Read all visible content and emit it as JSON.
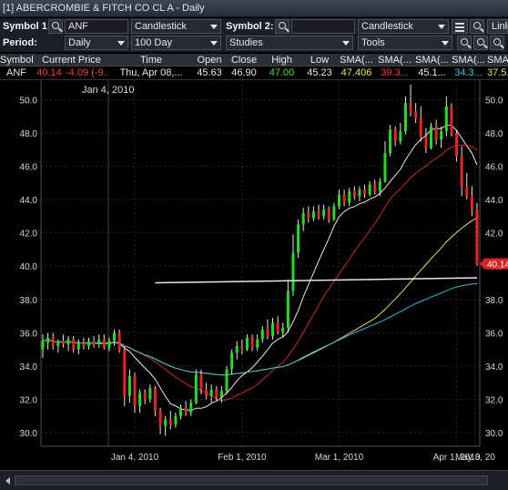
{
  "window": {
    "title": "[1] ABERCROMBIE & FITCH CO CL A - Daily"
  },
  "toolbar": {
    "symbol1_label": "Symbol 1:",
    "symbol1_value": "ANF",
    "chart_type1": "Candlestick",
    "symbol2_label": "Symbol 2:",
    "symbol2_value": "",
    "chart_type2": "Candlestick",
    "link_label": "Link",
    "period_label": "Period:",
    "period_value": "Daily",
    "range_value": "100 Day",
    "studies_label": "Studies",
    "tools_label": "Tools"
  },
  "quote": {
    "headers": [
      "Symbol",
      "Current Price",
      "Time",
      "Open",
      "Close",
      "High",
      "Low",
      "SMA(...",
      "SMA(...",
      "SMA(...",
      "SMA(...",
      "SMA(..."
    ],
    "row": [
      "ANF",
      "40.14",
      "-4.09 (-9...",
      "Thu, Apr 08,...",
      "45.63",
      "46.90",
      "47.00",
      "45.23",
      "47.406",
      "39.3...",
      "45.1...",
      "34.3...",
      "37.5..."
    ]
  },
  "colors": {
    "background": "#000000",
    "up_candle": "#22dd22",
    "down_candle": "#ee2222",
    "sma_white": "#e8e8e8",
    "sma_yellow": "#e2e255",
    "sma_red": "#cc2a2a",
    "sma_cyan": "#33bbcc",
    "price_tag": "#e02020"
  },
  "chart_data": {
    "type": "candlestick",
    "top_date_label": "Jan 4, 2010",
    "y_ticks": [
      "50.0",
      "48.0",
      "46.0",
      "44.0",
      "42.0",
      "40.0",
      "38.0",
      "36.0",
      "34.0",
      "32.0",
      "30.0"
    ],
    "x_ticks": [
      "Jan 4, 2010",
      "Feb 1, 2010",
      "Mar 1, 2010",
      "Apr 1, 2010",
      "May 3, 20"
    ],
    "ylim": [
      29.4,
      50.9
    ],
    "last_price_label": "40.14",
    "trendline": {
      "from": [
        22,
        39.0
      ],
      "to": [
        85,
        39.3
      ]
    },
    "candles": [
      {
        "o": 35.0,
        "h": 35.9,
        "l": 34.5,
        "c": 35.5
      },
      {
        "o": 35.4,
        "h": 36.0,
        "l": 35.0,
        "c": 35.7
      },
      {
        "o": 35.7,
        "h": 36.0,
        "l": 35.0,
        "c": 35.2
      },
      {
        "o": 35.2,
        "h": 35.6,
        "l": 34.8,
        "c": 35.5
      },
      {
        "o": 35.5,
        "h": 35.9,
        "l": 35.1,
        "c": 35.3
      },
      {
        "o": 35.3,
        "h": 35.8,
        "l": 34.9,
        "c": 35.6
      },
      {
        "o": 35.6,
        "h": 35.8,
        "l": 34.8,
        "c": 35.0
      },
      {
        "o": 35.0,
        "h": 35.6,
        "l": 34.7,
        "c": 35.4
      },
      {
        "o": 35.4,
        "h": 35.7,
        "l": 35.0,
        "c": 35.2
      },
      {
        "o": 35.2,
        "h": 35.7,
        "l": 35.0,
        "c": 35.5
      },
      {
        "o": 35.5,
        "h": 35.8,
        "l": 35.1,
        "c": 35.3
      },
      {
        "o": 35.3,
        "h": 35.9,
        "l": 35.1,
        "c": 35.6
      },
      {
        "o": 35.6,
        "h": 35.9,
        "l": 35.0,
        "c": 35.1
      },
      {
        "o": 35.1,
        "h": 35.7,
        "l": 34.9,
        "c": 35.5
      },
      {
        "o": 35.5,
        "h": 36.2,
        "l": 35.2,
        "c": 36.0
      },
      {
        "o": 36.0,
        "h": 36.2,
        "l": 34.8,
        "c": 35.0
      },
      {
        "o": 35.0,
        "h": 35.2,
        "l": 31.6,
        "c": 32.2
      },
      {
        "o": 32.2,
        "h": 33.8,
        "l": 31.8,
        "c": 33.4
      },
      {
        "o": 33.4,
        "h": 33.6,
        "l": 31.2,
        "c": 31.6
      },
      {
        "o": 31.6,
        "h": 32.6,
        "l": 31.2,
        "c": 32.4
      },
      {
        "o": 32.4,
        "h": 32.6,
        "l": 31.7,
        "c": 32.0
      },
      {
        "o": 32.0,
        "h": 32.9,
        "l": 31.8,
        "c": 32.7
      },
      {
        "o": 32.7,
        "h": 32.8,
        "l": 31.0,
        "c": 31.3
      },
      {
        "o": 31.3,
        "h": 31.5,
        "l": 29.9,
        "c": 30.4
      },
      {
        "o": 30.4,
        "h": 31.0,
        "l": 29.8,
        "c": 30.8
      },
      {
        "o": 30.8,
        "h": 31.3,
        "l": 30.2,
        "c": 30.5
      },
      {
        "o": 30.5,
        "h": 31.2,
        "l": 30.3,
        "c": 31.0
      },
      {
        "o": 31.0,
        "h": 31.7,
        "l": 30.8,
        "c": 31.5
      },
      {
        "o": 31.5,
        "h": 31.9,
        "l": 31.0,
        "c": 31.2
      },
      {
        "o": 31.2,
        "h": 32.0,
        "l": 31.0,
        "c": 31.8
      },
      {
        "o": 31.8,
        "h": 33.8,
        "l": 31.7,
        "c": 33.5
      },
      {
        "o": 33.5,
        "h": 33.8,
        "l": 32.3,
        "c": 32.6
      },
      {
        "o": 32.6,
        "h": 33.0,
        "l": 32.0,
        "c": 32.2
      },
      {
        "o": 32.2,
        "h": 32.9,
        "l": 31.8,
        "c": 32.6
      },
      {
        "o": 32.6,
        "h": 32.8,
        "l": 31.9,
        "c": 32.1
      },
      {
        "o": 32.1,
        "h": 32.8,
        "l": 31.8,
        "c": 32.5
      },
      {
        "o": 32.5,
        "h": 34.0,
        "l": 32.3,
        "c": 33.8
      },
      {
        "o": 33.8,
        "h": 35.0,
        "l": 33.5,
        "c": 34.8
      },
      {
        "o": 34.8,
        "h": 35.5,
        "l": 34.4,
        "c": 35.2
      },
      {
        "o": 35.2,
        "h": 35.6,
        "l": 34.7,
        "c": 35.0
      },
      {
        "o": 35.0,
        "h": 35.9,
        "l": 34.9,
        "c": 35.7
      },
      {
        "o": 35.7,
        "h": 35.9,
        "l": 34.9,
        "c": 35.1
      },
      {
        "o": 35.1,
        "h": 35.9,
        "l": 34.9,
        "c": 35.6
      },
      {
        "o": 35.6,
        "h": 36.4,
        "l": 35.4,
        "c": 36.2
      },
      {
        "o": 36.2,
        "h": 36.8,
        "l": 35.6,
        "c": 35.8
      },
      {
        "o": 35.8,
        "h": 36.9,
        "l": 35.6,
        "c": 36.6
      },
      {
        "o": 36.6,
        "h": 37.0,
        "l": 35.9,
        "c": 36.0
      },
      {
        "o": 36.0,
        "h": 36.6,
        "l": 35.7,
        "c": 36.3
      },
      {
        "o": 36.3,
        "h": 39.2,
        "l": 36.0,
        "c": 38.5
      },
      {
        "o": 38.5,
        "h": 41.9,
        "l": 38.2,
        "c": 40.8
      },
      {
        "o": 40.8,
        "h": 42.8,
        "l": 40.5,
        "c": 42.5
      },
      {
        "o": 42.5,
        "h": 43.5,
        "l": 42.1,
        "c": 43.2
      },
      {
        "o": 43.2,
        "h": 43.6,
        "l": 42.6,
        "c": 42.9
      },
      {
        "o": 42.9,
        "h": 43.6,
        "l": 42.7,
        "c": 43.3
      },
      {
        "o": 43.3,
        "h": 43.7,
        "l": 42.8,
        "c": 43.0
      },
      {
        "o": 43.0,
        "h": 43.7,
        "l": 42.8,
        "c": 43.4
      },
      {
        "o": 43.4,
        "h": 43.6,
        "l": 42.6,
        "c": 42.8
      },
      {
        "o": 42.8,
        "h": 43.8,
        "l": 42.7,
        "c": 43.6
      },
      {
        "o": 43.6,
        "h": 44.6,
        "l": 43.4,
        "c": 44.3
      },
      {
        "o": 44.3,
        "h": 44.6,
        "l": 43.6,
        "c": 43.8
      },
      {
        "o": 43.8,
        "h": 44.7,
        "l": 43.6,
        "c": 44.5
      },
      {
        "o": 44.5,
        "h": 44.8,
        "l": 44.0,
        "c": 44.2
      },
      {
        "o": 44.2,
        "h": 44.8,
        "l": 43.9,
        "c": 44.6
      },
      {
        "o": 44.6,
        "h": 44.9,
        "l": 44.1,
        "c": 44.3
      },
      {
        "o": 44.3,
        "h": 45.1,
        "l": 44.2,
        "c": 44.9
      },
      {
        "o": 44.9,
        "h": 45.2,
        "l": 44.3,
        "c": 44.5
      },
      {
        "o": 44.5,
        "h": 45.3,
        "l": 44.2,
        "c": 45.1
      },
      {
        "o": 45.1,
        "h": 47.5,
        "l": 45.0,
        "c": 46.8
      },
      {
        "o": 46.8,
        "h": 48.5,
        "l": 46.6,
        "c": 48.2
      },
      {
        "o": 48.2,
        "h": 48.4,
        "l": 47.2,
        "c": 47.5
      },
      {
        "o": 47.5,
        "h": 48.6,
        "l": 47.3,
        "c": 48.1
      },
      {
        "o": 48.1,
        "h": 50.2,
        "l": 47.9,
        "c": 49.8
      },
      {
        "o": 49.8,
        "h": 50.9,
        "l": 49.0,
        "c": 49.3
      },
      {
        "o": 49.3,
        "h": 49.8,
        "l": 48.6,
        "c": 48.9
      },
      {
        "o": 48.9,
        "h": 49.6,
        "l": 47.5,
        "c": 47.8
      },
      {
        "o": 47.8,
        "h": 48.3,
        "l": 46.8,
        "c": 47.1
      },
      {
        "o": 47.1,
        "h": 48.6,
        "l": 47.0,
        "c": 48.4
      },
      {
        "o": 48.4,
        "h": 48.8,
        "l": 47.3,
        "c": 47.6
      },
      {
        "o": 47.6,
        "h": 48.4,
        "l": 47.1,
        "c": 48.1
      },
      {
        "o": 48.1,
        "h": 50.2,
        "l": 47.8,
        "c": 49.6
      },
      {
        "o": 49.6,
        "h": 49.8,
        "l": 47.8,
        "c": 48.0
      },
      {
        "o": 48.0,
        "h": 48.2,
        "l": 46.3,
        "c": 46.6
      },
      {
        "o": 46.6,
        "h": 47.2,
        "l": 44.2,
        "c": 44.8
      },
      {
        "o": 44.8,
        "h": 45.6,
        "l": 44.0,
        "c": 44.2
      },
      {
        "o": 44.2,
        "h": 44.8,
        "l": 43.0,
        "c": 43.4
      },
      {
        "o": 43.4,
        "h": 43.8,
        "l": 40.0,
        "c": 40.14
      }
    ]
  }
}
